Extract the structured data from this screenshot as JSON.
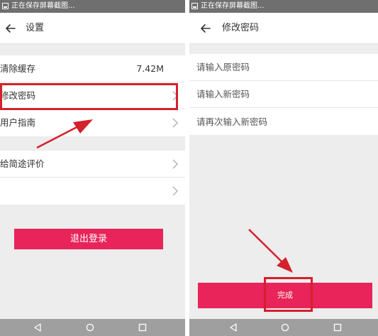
{
  "status_bar": {
    "text": "正在保存屏幕截图..."
  },
  "settings_screen": {
    "title": "设置",
    "group1": [
      {
        "label": "清除缓存",
        "value": "7.42M"
      },
      {
        "label": "修改密码"
      },
      {
        "label": "用户指南"
      }
    ],
    "group2": [
      {
        "label": "给简途评价"
      },
      {
        "label": ""
      }
    ],
    "logout_label": "退出登录"
  },
  "change_password_screen": {
    "title": "修改密码",
    "fields": [
      {
        "placeholder": "请输入原密码"
      },
      {
        "placeholder": "请输入新密码"
      },
      {
        "placeholder": "请再次输入新密码"
      }
    ],
    "done_label": "完成"
  },
  "annotations": {
    "highlight_color": "#d4212b"
  },
  "colors": {
    "accent": "#e8245a",
    "statusbar": "#6f6f6f",
    "navbar": "#9f9f9f"
  }
}
